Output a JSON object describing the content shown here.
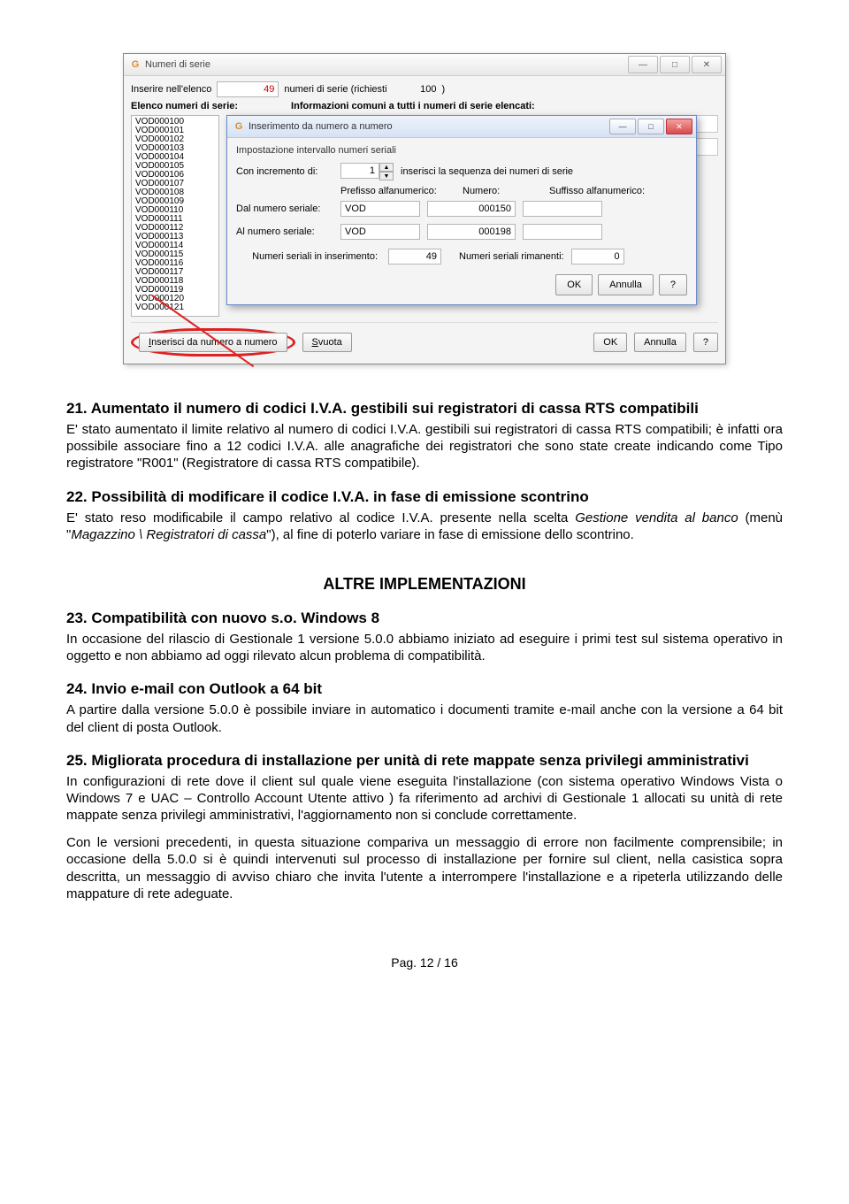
{
  "screenshot": {
    "outer_title": "Numeri di serie",
    "win_min": "—",
    "win_max": "□",
    "win_close": "✕",
    "row1_label": "Inserire nell'elenco",
    "row1_value": "49",
    "row1_suffix1": "numeri di serie (richiesti",
    "row1_suffix_val": "100",
    "row1_suffix_close": ")",
    "left_header": "Elenco numeri di serie:",
    "right_header": "Informazioni comuni a tutti i numeri di serie elencati:",
    "serials": "VOD000100\nVOD000101\nVOD000102\nVOD000103\nVOD000104\nVOD000105\nVOD000106\nVOD000107\nVOD000108\nVOD000109\nVOD000110\nVOD000111\nVOD000112\nVOD000113\nVOD000114\nVOD000115\nVOD000116\nVOD000117\nVOD000118\nVOD000119\nVOD000120\nVOD000121",
    "dialog_title": "Inserimento da numero a numero",
    "dialog_subtitle": "Impostazione intervallo numeri seriali",
    "incr_label": "Con incremento di:",
    "incr_value": "1",
    "incr_suffix": "inserisci la sequenza dei numeri di serie",
    "hdr_pref": "Prefisso alfanumerico:",
    "hdr_num": "Numero:",
    "hdr_suf": "Suffisso alfanumerico:",
    "from_label": "Dal numero seriale:",
    "from_pref": "VOD",
    "from_num": "000150",
    "to_label": "Al numero seriale:",
    "to_pref": "VOD",
    "to_num": "000198",
    "count_label": "Numeri seriali in inserimento:",
    "count_val": "49",
    "remain_label": "Numeri seriali rimanenti:",
    "remain_val": "0",
    "btn_ok": "OK",
    "btn_cancel": "Annulla",
    "btn_help": "?",
    "bottom_insert": "Inserisci da numero a numero",
    "bottom_svuota": "Svuota"
  },
  "doc": {
    "h21": "21. Aumentato il numero di codici I.V.A. gestibili sui registratori di cassa RTS compatibili",
    "p21": "E' stato aumentato il limite relativo al numero di codici I.V.A. gestibili sui registratori di cassa RTS compatibili; è infatti ora possibile associare fino a 12 codici I.V.A. alle anagrafiche dei registratori che sono state create indicando come Tipo registratore \"R001\" (Registratore di cassa RTS compatibile).",
    "h22": "22. Possibilità di modificare il codice I.V.A. in fase di emissione scontrino",
    "p22a": "E' stato reso modificabile il campo relativo al codice I.V.A. presente nella scelta ",
    "p22b": "Gestione vendita al banco",
    "p22c": " (menù \"",
    "p22d": "Magazzino \\ Registratori di cassa",
    "p22e": "\"), al fine di poterlo variare in fase di emissione dello scontrino.",
    "altre": "ALTRE IMPLEMENTAZIONI",
    "h23": "23. Compatibilità con nuovo s.o. Windows 8",
    "p23": "In occasione del rilascio di Gestionale 1 versione 5.0.0 abbiamo iniziato ad eseguire i primi test sul sistema operativo in oggetto e non abbiamo ad oggi rilevato alcun problema di compatibilità.",
    "h24": "24. Invio e-mail con Outlook a 64 bit",
    "p24": "A partire dalla versione 5.0.0 è possibile inviare in automatico i documenti tramite e-mail anche con la versione a 64 bit del client di posta Outlook.",
    "h25": "25. Migliorata procedura di installazione per unità di rete mappate senza privilegi amministrativi",
    "p25a": "In configurazioni di rete dove il client sul quale viene eseguita l'installazione (con sistema operativo Windows Vista o Windows 7 e UAC – Controllo Account Utente attivo ) fa riferimento ad archivi di Gestionale 1 allocati su unità di rete mappate senza privilegi amministrativi, l'aggiornamento non si conclude correttamente.",
    "p25b": "Con le versioni precedenti, in questa situazione compariva un messaggio di errore non facilmente comprensibile; in occasione della 5.0.0 si è quindi intervenuti sul processo di installazione per fornire sul client, nella casistica sopra descritta, un messaggio di avviso chiaro che invita l'utente a interrompere l'installazione e a ripeterla utilizzando delle mappature di rete adeguate.",
    "pager": "Pag. 12 / 16"
  }
}
